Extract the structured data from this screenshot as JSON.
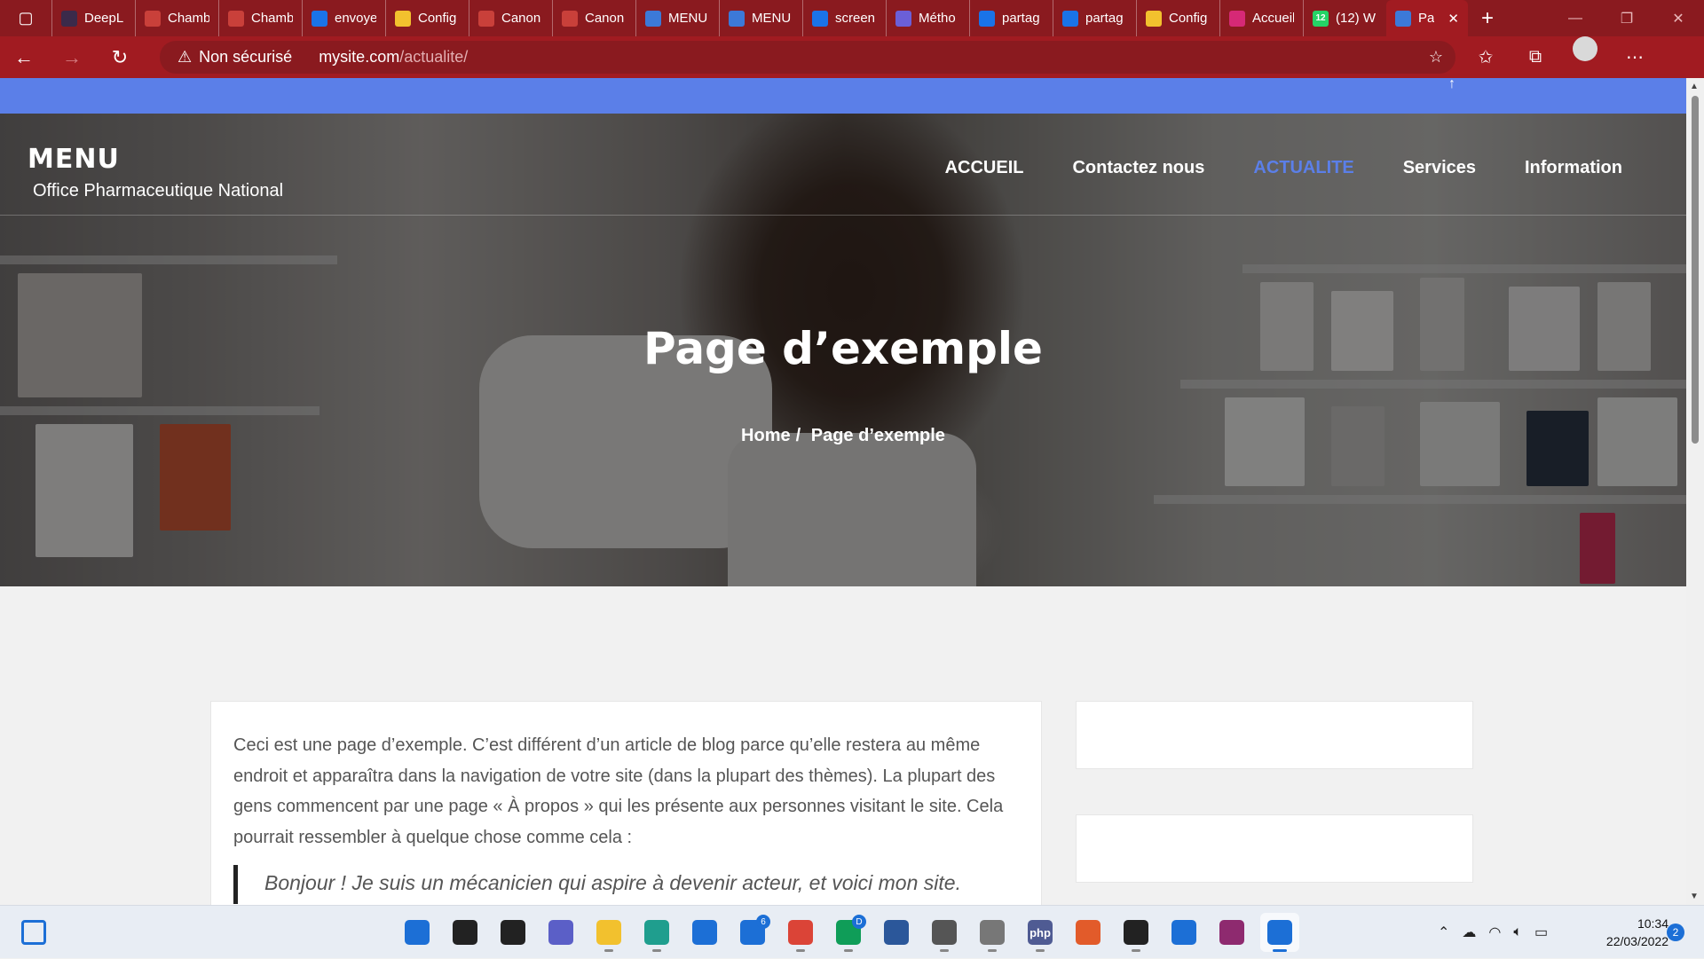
{
  "browser": {
    "tabs": [
      {
        "title": "DeepL",
        "icon": "deepl-icon",
        "color": "#3b2a4a"
      },
      {
        "title": "Chamb",
        "icon": "pdf-icon",
        "color": "#c9403a"
      },
      {
        "title": "Chamb",
        "icon": "pdf-icon",
        "color": "#c9403a"
      },
      {
        "title": "envoye",
        "icon": "bing-icon",
        "color": "#1a73e8"
      },
      {
        "title": "Config",
        "icon": "kanbox-icon",
        "color": "#f2c12e"
      },
      {
        "title": "Canon",
        "icon": "canon-icon",
        "color": "#c9403a"
      },
      {
        "title": "Canon",
        "icon": "canon-icon",
        "color": "#c9403a"
      },
      {
        "title": "MENU",
        "icon": "site-icon",
        "color": "#3c79d8"
      },
      {
        "title": "MENU",
        "icon": "site-icon",
        "color": "#3c79d8"
      },
      {
        "title": "screen",
        "icon": "bing-icon",
        "color": "#1a73e8"
      },
      {
        "title": "Métho",
        "icon": "method-icon",
        "color": "#6b5fd8"
      },
      {
        "title": "partag",
        "icon": "bing-icon",
        "color": "#1a73e8"
      },
      {
        "title": "partag",
        "icon": "bing-icon",
        "color": "#1a73e8"
      },
      {
        "title": "Config",
        "icon": "kanbox-icon",
        "color": "#f2c12e"
      },
      {
        "title": "Accueil",
        "icon": "instagram-icon",
        "color": "#d62976"
      },
      {
        "title": "(12) W",
        "icon": "whatsapp-icon",
        "color": "#25d366",
        "badge": "12"
      }
    ],
    "active_tab": {
      "title": "Pa",
      "icon": "site-icon",
      "color": "#3c79d8"
    },
    "security_label": "Non sécurisé",
    "url_host": "mysite.com",
    "url_path": "/actualite/"
  },
  "site": {
    "title": "MENU",
    "tagline": "Office Pharmaceutique National",
    "nav": [
      {
        "label": "ACCUEIL",
        "current": false
      },
      {
        "label": "Contactez nous",
        "current": false
      },
      {
        "label": "ACTUALITE",
        "current": true
      },
      {
        "label": "Services",
        "current": false
      },
      {
        "label": "Information",
        "current": false
      }
    ],
    "accent_color": "#5b7fe8",
    "hero_title": "Page d’exemple",
    "breadcrumb": {
      "home": "Home",
      "separator": "/",
      "current": "Page d’exemple"
    }
  },
  "content": {
    "paragraph": "Ceci est une page d’exemple. C’est différent d’un article de blog parce qu’elle restera au même endroit et apparaîtra dans la navigation de votre site (dans la plupart des thèmes). La plupart des gens commencent par une page « À propos » qui les présente aux personnes visitant le site. Cela pourrait ressembler à quelque chose comme cela :",
    "quote": "Bonjour ! Je suis un mécanicien qui aspire à devenir acteur, et voici mon site."
  },
  "taskbar": {
    "apps": [
      {
        "name": "start",
        "icon": "windows-icon",
        "color": "#1c6fd6"
      },
      {
        "name": "search",
        "icon": "search-icon",
        "color": "#222222"
      },
      {
        "name": "task-view",
        "icon": "task-view-icon",
        "color": "#222222"
      },
      {
        "name": "teams-chat",
        "icon": "chat-icon",
        "color": "#5b5fc7"
      },
      {
        "name": "file-explorer",
        "icon": "folder-icon",
        "color": "#f2c12e"
      },
      {
        "name": "edge",
        "icon": "edge-icon",
        "color": "#1f9e8e"
      },
      {
        "name": "store",
        "icon": "store-icon",
        "color": "#1c6fd6"
      },
      {
        "name": "mail",
        "icon": "mail-icon",
        "color": "#1c6fd6",
        "badge": "6"
      },
      {
        "name": "chrome-profile",
        "icon": "chrome-icon",
        "color": "#db4437"
      },
      {
        "name": "chrome",
        "icon": "chrome-icon",
        "color": "#0f9d58",
        "badge": "D"
      },
      {
        "name": "word",
        "icon": "word-icon",
        "color": "#2b579a"
      },
      {
        "name": "settings",
        "icon": "gear-icon",
        "color": "#555555"
      },
      {
        "name": "files",
        "icon": "archive-icon",
        "color": "#777777"
      },
      {
        "name": "php",
        "icon": "php-icon",
        "color": "#4f5b93"
      },
      {
        "name": "recorder",
        "icon": "record-icon",
        "color": "#e25b2a"
      },
      {
        "name": "media-player",
        "icon": "play-icon",
        "color": "#222222"
      },
      {
        "name": "notepad",
        "icon": "notepad-icon",
        "color": "#1c6fd6"
      },
      {
        "name": "winrar",
        "icon": "winrar-icon",
        "color": "#8e2a6f"
      },
      {
        "name": "snipping-tool",
        "icon": "snip-icon",
        "color": "#1c6fd6"
      }
    ],
    "php_label": "php",
    "time": "10:34",
    "date": "22/03/2022",
    "notifications": "2"
  }
}
